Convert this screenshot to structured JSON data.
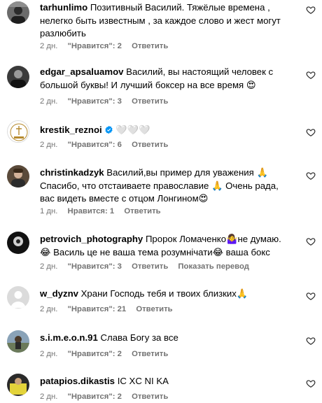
{
  "comments": [
    {
      "username": "tarhunlimo",
      "text": "Позитивный Василий. Тяжёлые времена , нелегко быть известным , за каждое слово и жест могут разлюбить",
      "time": "2 дн.",
      "likes": "\"Нравится\": 2",
      "reply": "Ответить",
      "avatar_icon": "avatar-photo-icon"
    },
    {
      "username": "edgar_apsaluamov",
      "text": "Василий, вы настоящий человек с большой буквы! И лучший боксер на все время 😍",
      "time": "2 дн.",
      "likes": "\"Нравится\": 3",
      "reply": "Ответить",
      "avatar_icon": "avatar-photo-icon"
    },
    {
      "username": "krestik_reznoi",
      "verified": true,
      "text": "🤍🤍🤍",
      "time": "2 дн.",
      "likes": "\"Нравится\": 6",
      "reply": "Ответить",
      "avatar_icon": "brand-logo-icon"
    },
    {
      "username": "christinkadzyk",
      "text": "Василий,вы пример для уважения 🙏 Спасибо, что отстаиваете православие 🙏 Очень рада, вас видеть вместе с отцом Лонгином😍",
      "time": "1 дн.",
      "likes": "Нравится: 1",
      "reply": "Ответить",
      "avatar_icon": "avatar-photo-icon"
    },
    {
      "username": "petrovich_photography",
      "text": "Пророк Ломаченко🤷‍♀️не думаю. 😂 Василь це не ваша тема розумнічати😂 ваша бокс",
      "time": "2 дн.",
      "likes": "\"Нравится\": 3",
      "reply": "Ответить",
      "translate": "Показать перевод",
      "avatar_icon": "avatar-photo-icon"
    },
    {
      "username": "w_dyznv",
      "text": "Храни Господь тебя и твоих близких🙏",
      "time": "2 дн.",
      "likes": "\"Нравится\": 21",
      "reply": "Ответить",
      "avatar_icon": "default-avatar-icon"
    },
    {
      "username": "s.i.m.e.o.n.91",
      "text": "Слава Богу за все",
      "time": "2 дн.",
      "likes": "\"Нравится\": 2",
      "reply": "Ответить",
      "avatar_icon": "avatar-photo-icon"
    },
    {
      "username": "patapios.dikastis",
      "text": "IC XC NI KA",
      "time": "2 дн.",
      "likes": "\"Нравится\": 2",
      "reply": "Ответить",
      "avatar_icon": "avatar-photo-icon"
    }
  ],
  "colors": {
    "meta_text": "#737373",
    "verified_badge": "#0095f6"
  }
}
